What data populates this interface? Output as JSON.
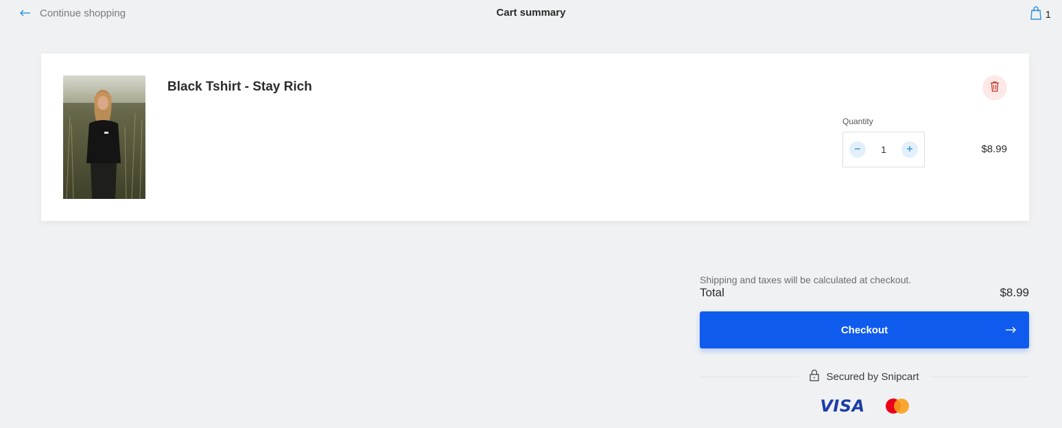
{
  "header": {
    "back_label": "Continue shopping",
    "title": "Cart summary",
    "cart_count": "1"
  },
  "item": {
    "name": "Black Tshirt - Stay Rich",
    "quantity_label": "Quantity",
    "quantity": "1",
    "price": "$8.99",
    "image_icon": "product-photo"
  },
  "summary": {
    "shipping_note": "Shipping and taxes will be calculated at checkout.",
    "total_label": "Total",
    "total_value": "$8.99",
    "checkout_label": "Checkout",
    "secured_label": "Secured by Snipcart",
    "payment_methods": [
      "VISA",
      "mastercard"
    ]
  },
  "colors": {
    "accent": "#0f5bed",
    "link_blue": "#2a8fd6",
    "remove_bg": "#fde8e8",
    "remove_icon": "#c0392b",
    "page_bg": "#f0f1f3"
  }
}
